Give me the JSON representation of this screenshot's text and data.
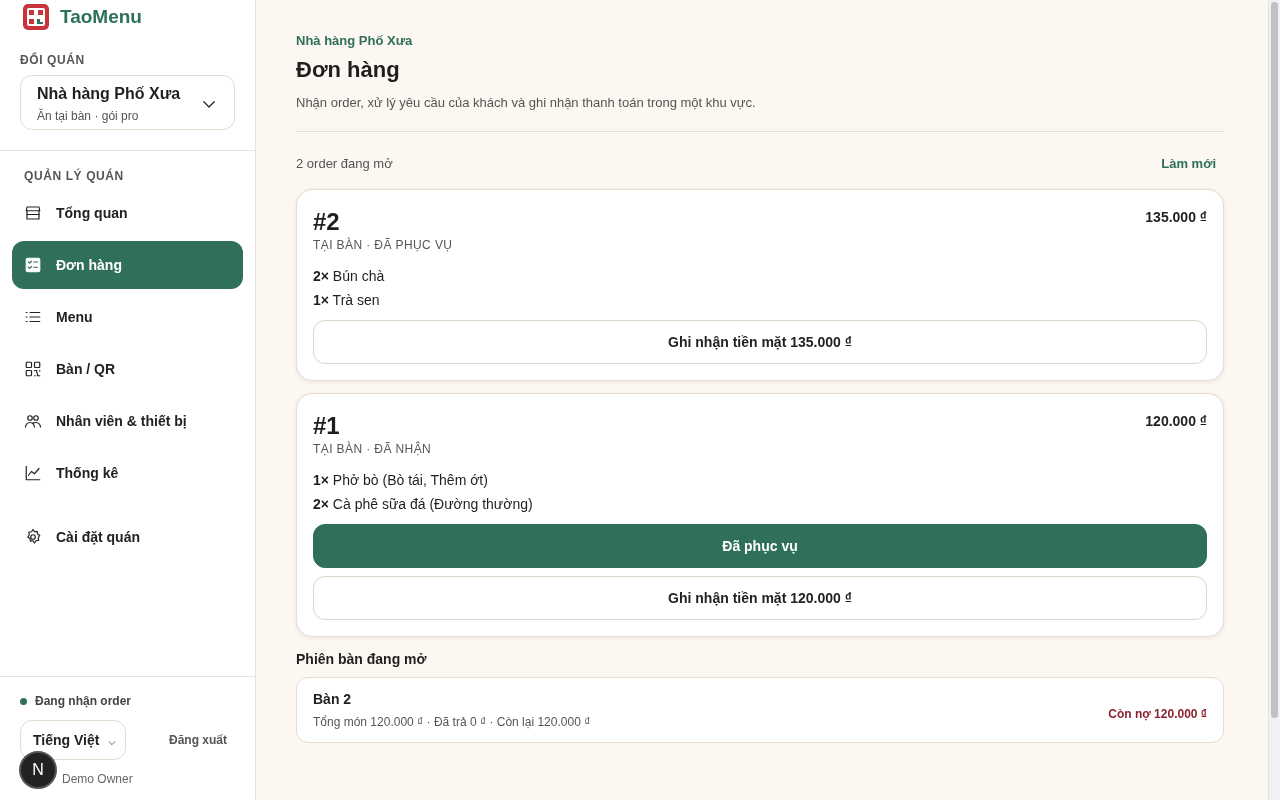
{
  "brand": {
    "name": "TaoMenu"
  },
  "switcher": {
    "label": "ĐỔI QUÁN",
    "name": "Nhà hàng Phố Xưa",
    "subtitle": "Ăn tại bàn · gói pro"
  },
  "nav_section": "QUẢN LÝ QUÁN",
  "nav": [
    {
      "label": "Tổng quan",
      "selected": false
    },
    {
      "label": "Đơn hàng",
      "selected": true
    },
    {
      "label": "Menu",
      "selected": false
    },
    {
      "label": "Bàn / QR",
      "selected": false
    },
    {
      "label": "Nhân viên & thiết bị",
      "selected": false
    },
    {
      "label": "Thống kê",
      "selected": false
    },
    {
      "label": "Cài đặt quán",
      "selected": false
    }
  ],
  "footer": {
    "status": "Đang nhận order",
    "language": "Tiếng Việt",
    "logout": "Đăng xuất",
    "user": "Demo Owner",
    "badge": "N"
  },
  "page": {
    "eyebrow": "Nhà hàng Phố Xưa",
    "title": "Đơn hàng",
    "description": "Nhận order, xử lý yêu cầu của khách và ghi nhận thanh toán trong một khu vực."
  },
  "orders_header": {
    "count": "2 order đang mở",
    "refresh": "Làm mới"
  },
  "orders": [
    {
      "number": "#2",
      "meta": "TẠI BÀN · ĐÃ PHỤC VỤ",
      "total": "135.000 ₫",
      "items": [
        {
          "qty": "2×",
          "name": "Bún chà"
        },
        {
          "qty": "1×",
          "name": "Trà sen"
        }
      ],
      "actions": [
        {
          "kind": "outline",
          "label": "Ghi nhận tiền mặt 135.000 ₫"
        }
      ]
    },
    {
      "number": "#1",
      "meta": "TẠI BÀN · ĐÃ NHẬN",
      "total": "120.000 ₫",
      "items": [
        {
          "qty": "1×",
          "name": "Phở bò (Bò tái, Thêm ớt)"
        },
        {
          "qty": "2×",
          "name": "Cà phê sữa đá (Đường thường)"
        }
      ],
      "actions": [
        {
          "kind": "primary",
          "label": "Đã phục vụ"
        },
        {
          "kind": "outline",
          "label": "Ghi nhận tiền mặt 120.000 ₫"
        }
      ]
    }
  ],
  "sessions": {
    "title": "Phiên bàn đang mở",
    "rows": [
      {
        "name": "Bàn 2",
        "summary": "Tổng món 120.000 ₫ · Đã trả 0 ₫ · Còn lại 120.000 ₫",
        "due": "Còn nợ 120.000 ₫"
      }
    ]
  }
}
